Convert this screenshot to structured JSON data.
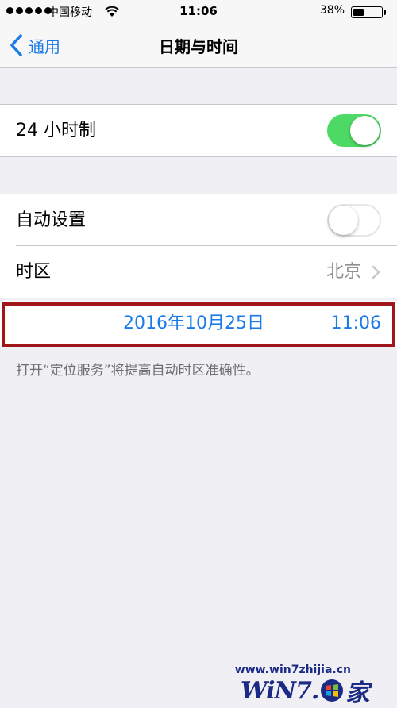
{
  "status_bar": {
    "carrier": "中国移动",
    "time": "11:06",
    "battery_percent": "38%",
    "battery_level": 0.38
  },
  "nav": {
    "back_label": "通用",
    "title": "日期与时间"
  },
  "settings": {
    "hour24": {
      "label": "24 小时制",
      "enabled": true
    },
    "auto_set": {
      "label": "自动设置",
      "enabled": false
    },
    "timezone": {
      "label": "时区",
      "value": "北京"
    },
    "date": "2016年10月25日",
    "time": "11:06",
    "footer_note": "打开“定位服务”将提高自动时区准确性。"
  },
  "watermark": {
    "url": "www.win7zhijia.cn",
    "logo_text_left": "WiN7.",
    "logo_text_right": "家"
  },
  "colors": {
    "accent": "#1a7ae8",
    "switch_on": "#4cd964",
    "highlight_border": "#a0161b"
  }
}
